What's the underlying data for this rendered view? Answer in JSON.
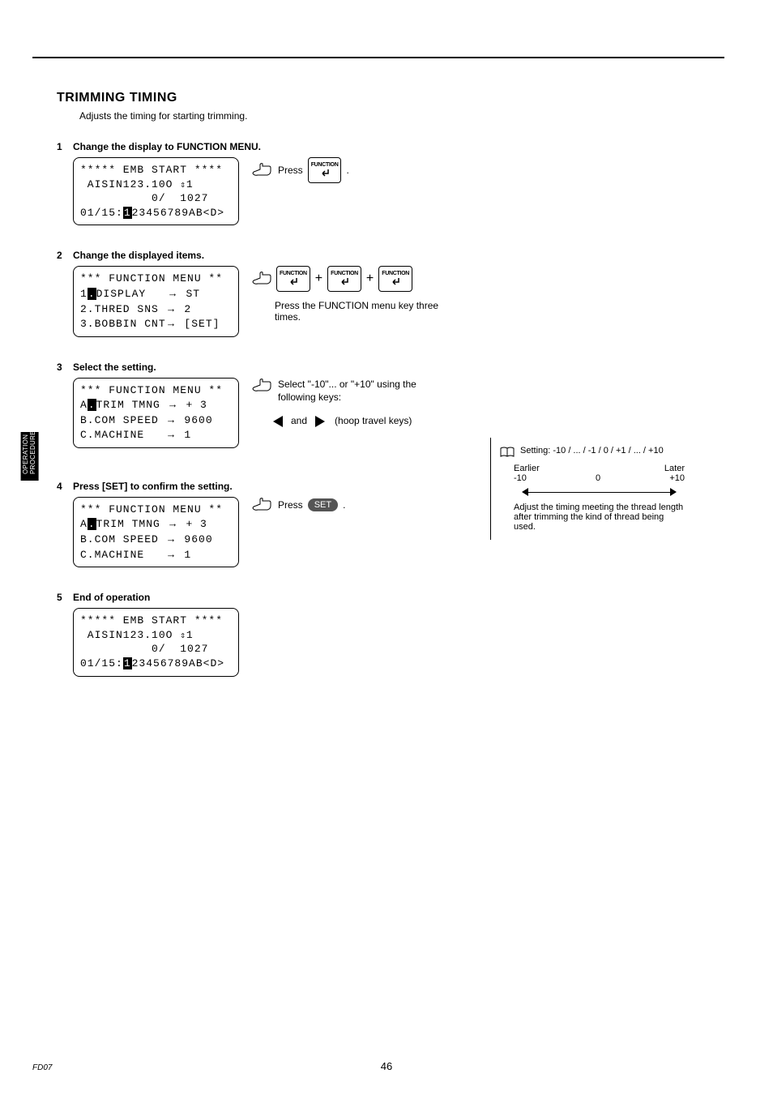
{
  "header": {
    "title": "TRIMMING TIMING",
    "intro": "Adjusts the timing for starting trimming."
  },
  "steps": {
    "s1": {
      "num": "1",
      "title": "Change the display to FUNCTION MENU.",
      "press_before": "Press",
      "press_after": ".",
      "key_label": "FUNCTION"
    },
    "s2": {
      "num": "2",
      "title": "Change the displayed items.",
      "instr_text": "Press the FUNCTION menu key three times.",
      "key_label": "FUNCTION"
    },
    "s3": {
      "num": "3",
      "title": "Select the setting.",
      "instr_text": "Select \"-10\"... or \"+10\" using the following keys:",
      "and_text": "and",
      "hoop_text": "(hoop travel keys)"
    },
    "s4": {
      "num": "4",
      "title": "Press [SET] to confirm the setting.",
      "press_before": "Press",
      "press_after": ".",
      "set_label": "SET"
    },
    "s5": {
      "num": "5",
      "title": "End of operation"
    }
  },
  "lcd": {
    "s1": {
      "l1": "***** EMB START ****",
      "l2a": " AISIN123.10O ",
      "updown1": "⇕",
      "l2b": "1",
      "l3": "          0/  1027",
      "l4a": "01/15:",
      "cursor": "1",
      "l4b": "23456789AB<D>"
    },
    "s2": {
      "l1": "*** FUNCTION MENU **",
      "l2a": "1",
      "cursor": ".",
      "l2b": "DISPLAY   ",
      "arr": "→",
      "l2c": " ST",
      "l3a": "2.THRED SNS ",
      "l3arr": "→",
      "l3b": " 2",
      "l4a": "3.BOBBIN CNT",
      "l4arr": "→",
      "l4b": " [SET]"
    },
    "s3": {
      "l1": "*** FUNCTION MENU **",
      "l2a": "A",
      "cursor": ".",
      "l2b": "TRIM TMNG ",
      "arr": "→",
      "l2c": " + 3",
      "l3a": "B.COM SPEED ",
      "l3arr": "→",
      "l3b": " 9600",
      "l4a": "C.MACHINE   ",
      "l4arr": "→",
      "l4b": " 1"
    },
    "s4": {
      "l1": "*** FUNCTION MENU **",
      "l2a": "A",
      "cursor": ".",
      "l2b": "TRIM TMNG ",
      "arr": "→",
      "l2c": " + 3",
      "l3a": "B.COM SPEED ",
      "l3arr": "→",
      "l3b": " 9600",
      "l4a": "C.MACHINE   ",
      "l4arr": "→",
      "l4b": " 1"
    },
    "s5": {
      "l1": "***** EMB START ****",
      "l2a": " AISIN123.10O ",
      "updown1": "⇕",
      "l2b": "1",
      "l3": "          0/  1027",
      "l4a": "01/15:",
      "cursor": "1",
      "l4b": "23456789AB<D>"
    }
  },
  "tip": {
    "setting": "Setting: -10 / ... / -1 / 0 / +1 / ... / +10",
    "earlier": "Earlier",
    "later": "Later",
    "minus10": "-10",
    "zero": "0",
    "plus10": "+10",
    "adjust": "Adjust the timing meeting the thread length after trimming the kind of thread being used."
  },
  "sidebar": {
    "label": "OPERATION PROCEDURE"
  },
  "footer": {
    "doc": "FD07",
    "page": "46"
  }
}
